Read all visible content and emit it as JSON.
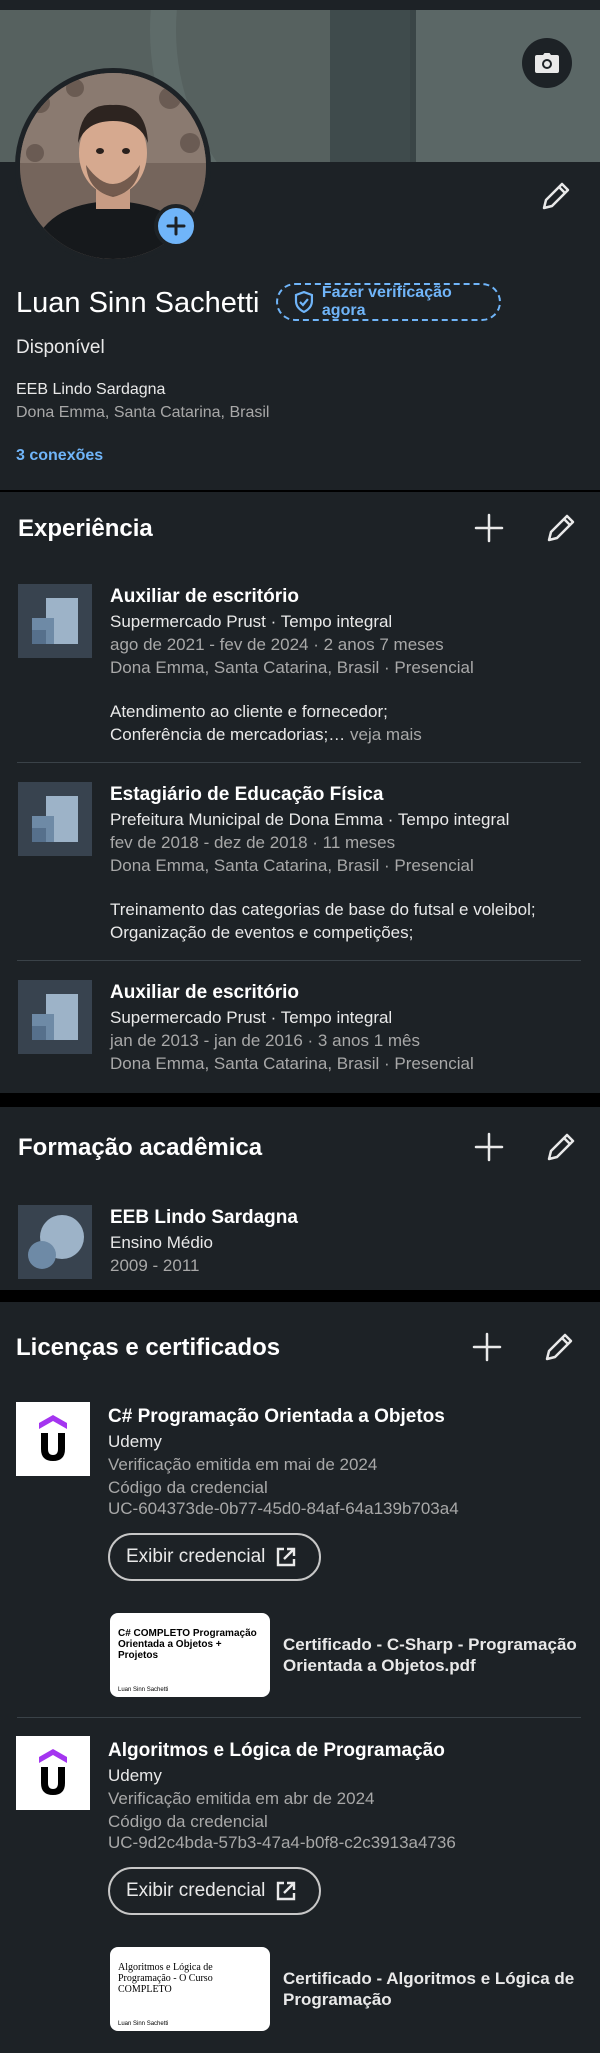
{
  "profile": {
    "name": "Luan Sinn Sachetti",
    "verify_label": "Fazer verificação agora",
    "headline": "Disponível",
    "school": "EEB Lindo Sardagna",
    "location": "Dona Emma, Santa Catarina, Brasil",
    "connections": "3 conexões"
  },
  "experience": {
    "title": "Experiência",
    "items": [
      {
        "role": "Auxiliar de escritório",
        "company": "Supermercado Prust · Tempo integral",
        "dates": "ago de 2021 - fev de 2024 · 2 anos 7 meses",
        "place": "Dona Emma, Santa Catarina, Brasil · Presencial",
        "desc1": "Atendimento ao cliente e fornecedor;",
        "desc2": "Conferência de mercadorias;…",
        "more": " veja mais"
      },
      {
        "role": "Estagiário de Educação Física",
        "company": "Prefeitura Municipal de Dona Emma · Tempo integral",
        "dates": "fev de 2018 - dez de 2018 · 11 meses",
        "place": "Dona Emma, Santa Catarina, Brasil · Presencial",
        "desc1": "Treinamento das categorias de base do futsal e voleibol;",
        "desc2": "Organização de eventos e competições;"
      },
      {
        "role": "Auxiliar de escritório",
        "company": "Supermercado Prust · Tempo integral",
        "dates": "jan de 2013 - jan de 2016 · 3 anos 1 mês",
        "place": "Dona Emma, Santa Catarina, Brasil · Presencial"
      }
    ]
  },
  "education": {
    "title": "Formação acadêmica",
    "items": [
      {
        "school": "EEB Lindo Sardagna",
        "degree": "Ensino Médio",
        "dates": "2009 - 2011"
      }
    ]
  },
  "licenses": {
    "title": "Licenças e certificados",
    "button_label": "Exibir credencial",
    "items": [
      {
        "name": "C# Programação Orientada a Objetos",
        "issuer": "Udemy",
        "issued": "Verificação emitida em mai de 2024",
        "cred_label": "Código da credencial",
        "cred_id": "UC-604373de-0b77-45d0-84af-64a139b703a4",
        "thumb_text": "C# COMPLETO Programação Orientada a Objetos + Projetos",
        "thumb_sign": "Luan Sinn Sachetti",
        "media_title": "Certificado - C-Sharp - Programação Orientada a Objetos.pdf"
      },
      {
        "name": "Algoritmos e Lógica de Programação",
        "issuer": "Udemy",
        "issued": "Verificação emitida em abr de 2024",
        "cred_label": "Código da credencial",
        "cred_id": "UC-9d2c4bda-57b3-47a4-b0f8-c2c3913a4736",
        "thumb_text": "Algoritmos e Lógica de Programação - O Curso COMPLETO",
        "thumb_sign": "Luan Sinn Sachetti",
        "media_title": "Certificado - Algoritmos e Lógica de Programação"
      }
    ]
  },
  "icons": {
    "camera": "camera-icon",
    "add": "plus-icon",
    "edit": "pencil-icon",
    "verify": "shield-check-icon",
    "external": "external-link-icon"
  },
  "colors": {
    "background": "#1d2226",
    "accent": "#70b5f9",
    "udemy_purple": "#a435f0"
  }
}
